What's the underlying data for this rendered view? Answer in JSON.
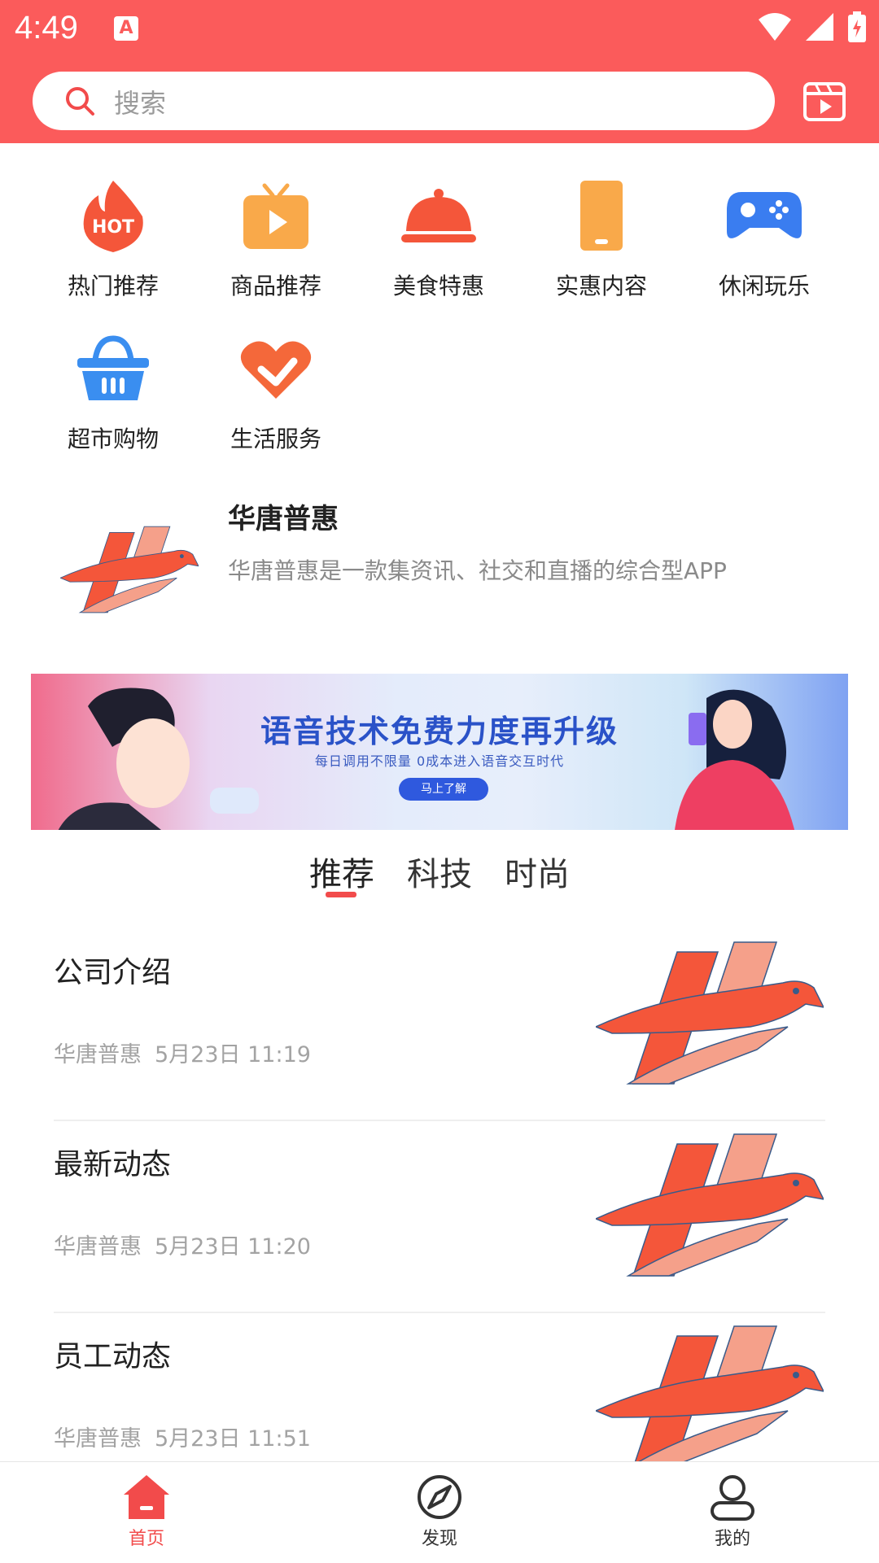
{
  "status": {
    "time": "4:49",
    "app_badge": "A"
  },
  "search": {
    "placeholder": "搜索"
  },
  "categories": [
    {
      "label": "热门推荐",
      "icon": "hot-flame-icon",
      "text": "HOT"
    },
    {
      "label": "商品推荐",
      "icon": "tv-play-icon"
    },
    {
      "label": "美食特惠",
      "icon": "food-cloche-icon"
    },
    {
      "label": "实惠内容",
      "icon": "phone-icon"
    },
    {
      "label": "休闲玩乐",
      "icon": "gamepad-icon"
    },
    {
      "label": "超市购物",
      "icon": "shopping-basket-icon"
    },
    {
      "label": "生活服务",
      "icon": "heart-service-icon"
    }
  ],
  "intro": {
    "title": "华唐普惠",
    "desc": "华唐普惠是一款集资讯、社交和直播的综合型APP"
  },
  "banner": {
    "title": "语音技术免费力度再升级",
    "subtitle": "每日调用不限量    0成本进入语音交互时代",
    "button": "马上了解"
  },
  "tabs": [
    {
      "label": "推荐",
      "active": true
    },
    {
      "label": "科技",
      "active": false
    },
    {
      "label": "时尚",
      "active": false
    }
  ],
  "feed": [
    {
      "title": "公司介绍",
      "source": "华唐普惠",
      "time": "5月23日 11:19"
    },
    {
      "title": "最新动态",
      "source": "华唐普惠",
      "time": "5月23日 11:20"
    },
    {
      "title": "员工动态",
      "source": "华唐普惠",
      "time": "5月23日 11:51"
    }
  ],
  "bottom_nav": [
    {
      "label": "首页",
      "active": true
    },
    {
      "label": "发现",
      "active": false
    },
    {
      "label": "我的",
      "active": false
    }
  ],
  "colors": {
    "header": "#fb5b5b",
    "accent": "#f24b4b",
    "logo_red": "#f55a3a",
    "logo_peach": "#f5a08a"
  }
}
